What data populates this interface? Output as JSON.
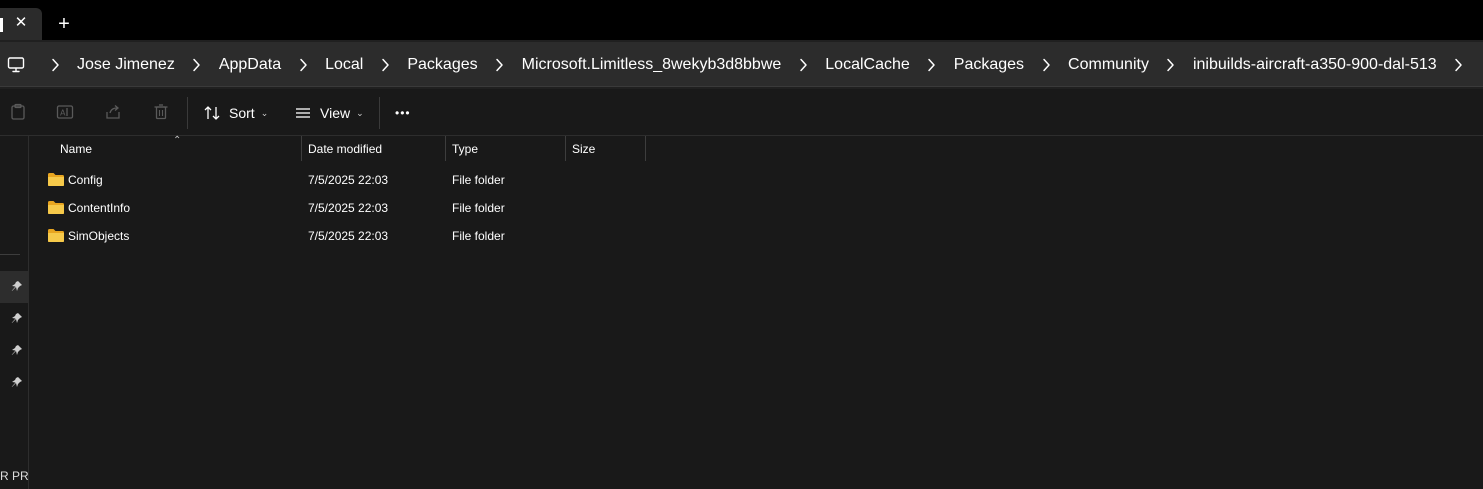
{
  "window": {
    "tab_close": "✕",
    "new_tab": "+"
  },
  "breadcrumb": {
    "items": [
      "Jose Jimenez",
      "AppData",
      "Local",
      "Packages",
      "Microsoft.Limitless_8wekyb3d8bbwe",
      "LocalCache",
      "Packages",
      "Community",
      "inibuilds-aircraft-a350-900-dal-513"
    ],
    "root_icon": "computer-icon",
    "separator_icon": "chevron-right-icon"
  },
  "toolbar": {
    "icons": [
      "paste-icon",
      "rename-icon",
      "share-icon",
      "delete-icon"
    ],
    "sort_label": "Sort",
    "view_label": "View",
    "more_label": "•••"
  },
  "nav_pane": {
    "pins": 4,
    "bottom_text": "R PRO"
  },
  "file_list": {
    "columns": [
      "Name",
      "Date modified",
      "Type",
      "Size"
    ],
    "sorted_by": "Name",
    "rows": [
      {
        "name": "Config",
        "date": "7/5/2025 22:03",
        "type": "File folder",
        "size": ""
      },
      {
        "name": "ContentInfo",
        "date": "7/5/2025 22:03",
        "type": "File folder",
        "size": ""
      },
      {
        "name": "SimObjects",
        "date": "7/5/2025 22:03",
        "type": "File folder",
        "size": ""
      }
    ]
  },
  "colors": {
    "background": "#191919",
    "titlebar": "#000000",
    "address_field": "#2c2c2c",
    "folder_yellow": "#f4c542",
    "text": "#ffffff"
  }
}
